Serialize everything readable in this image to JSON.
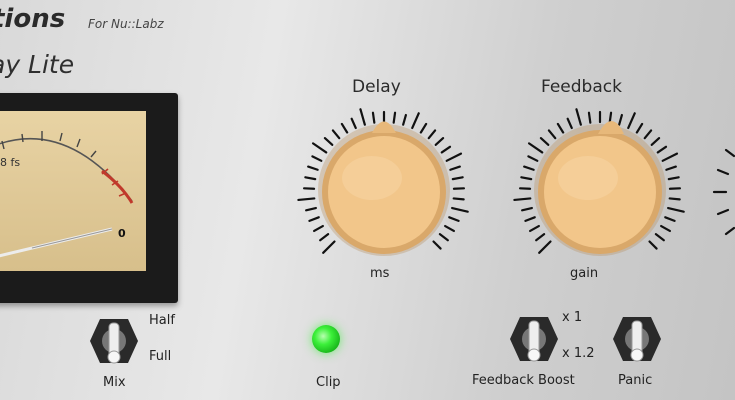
{
  "header": {
    "brand": "tions",
    "vendor": "For Nu::Labz",
    "product": "ay Lite"
  },
  "meter": {
    "scale_label": "8 fs",
    "zero_label": "0"
  },
  "knobs": {
    "delay": {
      "title": "Delay",
      "unit": "ms"
    },
    "feedback": {
      "title": "Feedback",
      "unit": "gain"
    }
  },
  "switches": {
    "mix": {
      "label": "Mix",
      "top_option": "Half",
      "bottom_option": "Full"
    },
    "feedback_boost": {
      "label": "Feedback Boost",
      "top_option": "x 1",
      "bottom_option": "x 1.2"
    },
    "panic": {
      "label": "Panic"
    }
  },
  "indicators": {
    "clip": {
      "label": "Clip",
      "color": "#3cf03a"
    }
  },
  "colors": {
    "knob": "#f2c68a",
    "panel": "#d9d9d9",
    "meter_face": "#e0c996"
  }
}
